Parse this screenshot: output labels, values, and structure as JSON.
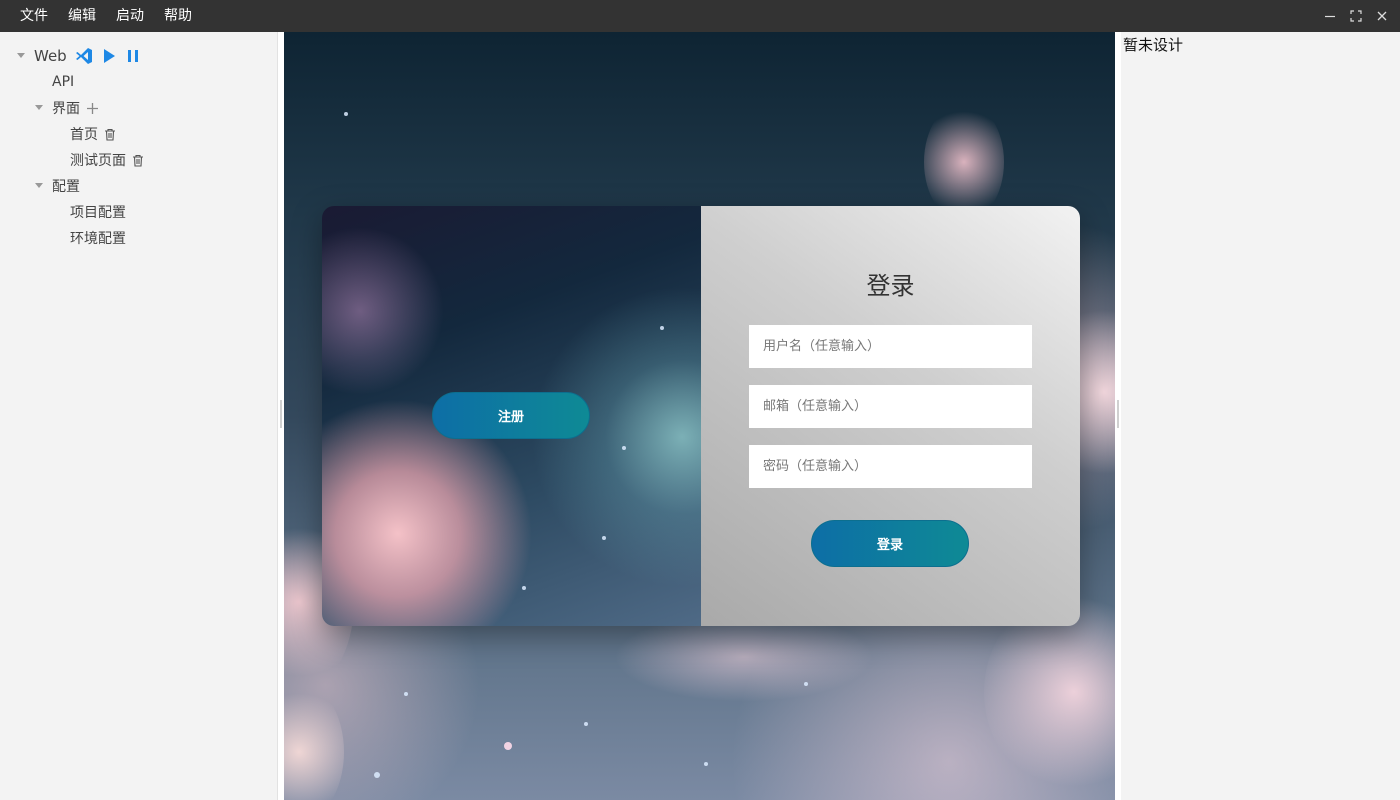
{
  "menubar": {
    "items": [
      "文件",
      "编辑",
      "启动",
      "帮助"
    ]
  },
  "window_controls": [
    "minimize-icon",
    "maximize-icon",
    "close-icon"
  ],
  "tree": {
    "root": {
      "label": "Web",
      "icons": [
        "vscode-icon",
        "play-icon",
        "pause-icon"
      ]
    },
    "api": {
      "label": "API"
    },
    "ui": {
      "label": "界面",
      "icon": "plus-icon"
    },
    "pages": [
      {
        "label": "首页",
        "icon": "trash-icon"
      },
      {
        "label": "测试页面",
        "icon": "trash-icon"
      }
    ],
    "config": {
      "label": "配置"
    },
    "config_items": [
      {
        "label": "项目配置"
      },
      {
        "label": "环境配置"
      }
    ]
  },
  "login": {
    "title": "登录",
    "username_placeholder": "用户名（任意输入）",
    "email_placeholder": "邮箱（任意输入）",
    "password_placeholder": "密码（任意输入）",
    "login_button": "登录",
    "register_button": "注册"
  },
  "colors": {
    "accent": "#0e7fa0",
    "icon_blue": "#1e88e5"
  },
  "right_panel": {
    "text": "暂未设计"
  }
}
